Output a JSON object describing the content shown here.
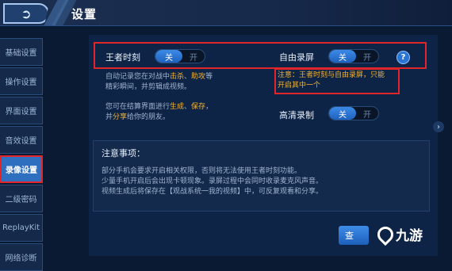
{
  "header": {
    "title": "设置",
    "back_icon": "back-arrow-icon"
  },
  "sidebar": {
    "items": [
      {
        "label": "基础设置"
      },
      {
        "label": "操作设置"
      },
      {
        "label": "界面设置"
      },
      {
        "label": "音效设置"
      },
      {
        "label": "录像设置",
        "active": true
      },
      {
        "label": "二级密码"
      },
      {
        "label": "ReplayKit"
      },
      {
        "label": "网络诊断"
      }
    ]
  },
  "settings": {
    "king_moment": {
      "label": "王者时刻",
      "on_label": "关",
      "off_label": "开"
    },
    "free_record": {
      "label": "自由录屏",
      "on_label": "关",
      "off_label": "开",
      "help": "?"
    },
    "hd_record": {
      "label": "高清录制",
      "on_label": "关",
      "off_label": "开"
    }
  },
  "descriptions": {
    "auto_record_prefix": "自动记录您在对战中",
    "auto_record_kill": "击杀",
    "auto_record_sep": "、",
    "auto_record_assist": "助攻",
    "auto_record_suffix": "等",
    "auto_record_line2": "精彩瞬间，并剪辑成视频。",
    "settle_prefix": "您可在结算界面进行",
    "settle_generate": "生成",
    "settle_sep": "、",
    "settle_save": "保存",
    "settle_suffix": "，",
    "settle_line2_prefix": "并",
    "settle_share": "分享",
    "settle_line2_suffix": "给你的朋友。"
  },
  "warning": {
    "line1": "注意：王者时刻与自由录屏，只能",
    "line2": "开启其中一个"
  },
  "notice": {
    "title": "注意事项：",
    "lines": [
      "部分手机会要求开启相关权限，否则将无法使用王者时刻功能。",
      "少量手机开启后会出现卡顿现象。录屏过程中会同时收录麦克风声音。",
      "视频生成后将保存在【观战系统一我的视频】中，可反复观看和分享。"
    ]
  },
  "buttons": {
    "query": "查"
  },
  "watermark": {
    "text": "九游"
  },
  "colors": {
    "accent": "#2f6fc0",
    "highlight": "#f2b233",
    "annotation": "#e0262b"
  }
}
